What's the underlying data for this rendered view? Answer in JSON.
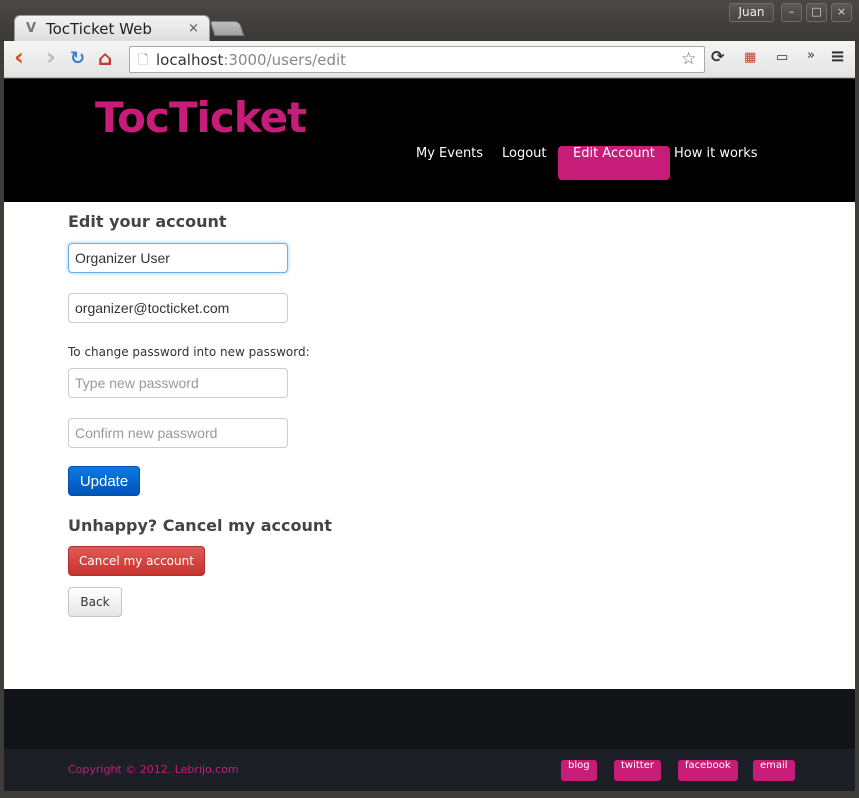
{
  "browser": {
    "tab_title": "TocTicket Web",
    "tab_favicon": "V",
    "tab_close": "×",
    "user_name": "Juan",
    "url_host": "localhost",
    "url_rest": ":3000/users/edit",
    "icons": {
      "back": "‹",
      "forward": "›",
      "reload": "↻",
      "home": "⌂",
      "page": "🗋",
      "star": "☆",
      "sync": "⟳",
      "flag": "▦",
      "ruler": "▭",
      "more": "»",
      "menu": "≡",
      "minimize": "–",
      "maximize": "□",
      "close": "×"
    }
  },
  "site": {
    "brand": "TocTicket",
    "brand_color": "#c71c77",
    "nav": [
      {
        "label": "My Events"
      },
      {
        "label": "Logout"
      },
      {
        "label": "Edit Account",
        "active": true
      },
      {
        "label": "How it works"
      }
    ]
  },
  "form": {
    "heading": "Edit your account",
    "name_value": "Organizer User",
    "email_value": "organizer@tocticket.com",
    "password_label": "To change password into new password:",
    "password_placeholder": "Type new password",
    "confirm_placeholder": "Confirm new password",
    "update_label": "Update"
  },
  "cancel": {
    "heading": "Unhappy? Cancel my account",
    "cancel_label": "Cancel my account",
    "back_label": "Back"
  },
  "footer": {
    "copyright": "Copyright © 2012. Lebrijo.com",
    "links": [
      "blog",
      "twitter",
      "facebook",
      "email"
    ]
  }
}
